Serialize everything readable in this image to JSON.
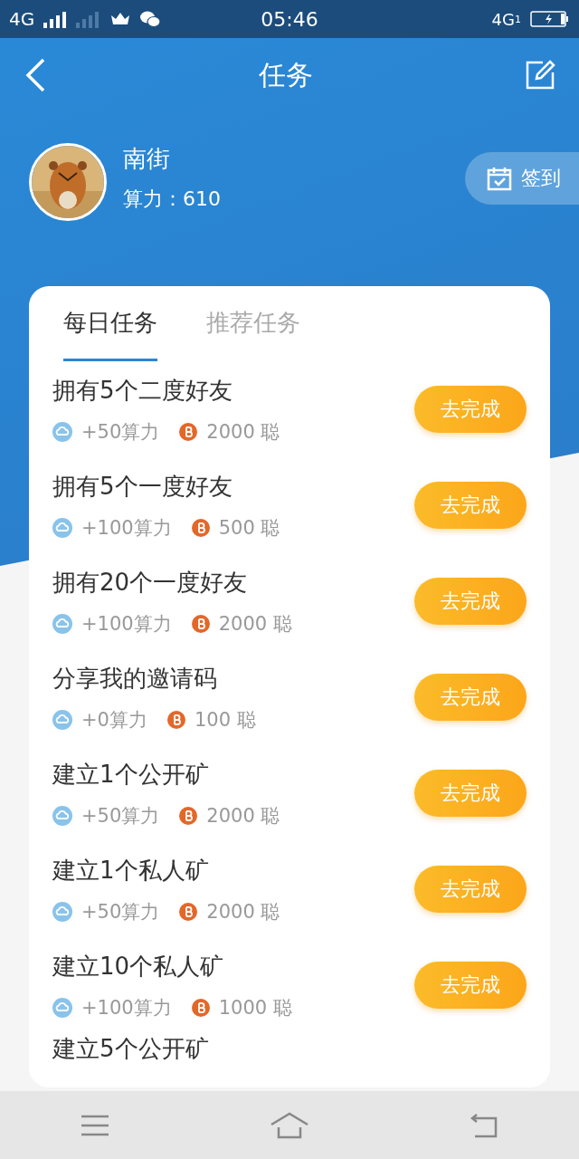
{
  "status_bar": {
    "network": "4G",
    "time": "05:46",
    "data_network": "4G",
    "sim": "1"
  },
  "header": {
    "title": "任务"
  },
  "profile": {
    "name": "南街",
    "power": "算力：610",
    "checkin": "签到"
  },
  "tabs": [
    {
      "label": "每日任务",
      "selected": true
    },
    {
      "label": "推荐任务",
      "selected": false
    }
  ],
  "tasks": [
    {
      "kind": "full",
      "title": "拥有5个二度好友",
      "power": "+50算力",
      "coins": "2000 聪",
      "action": "去完成"
    },
    {
      "kind": "full",
      "title": "拥有5个一度好友",
      "power": "+100算力",
      "coins": "500 聪",
      "action": "去完成"
    },
    {
      "kind": "full",
      "title": "拥有20个一度好友",
      "power": "+100算力",
      "coins": "2000 聪",
      "action": "去完成"
    },
    {
      "kind": "full",
      "title": "分享我的邀请码",
      "power": "+0算力",
      "coins": "100 聪",
      "action": "去完成"
    },
    {
      "kind": "full",
      "title": "建立1个公开矿",
      "power": "+50算力",
      "coins": "2000 聪",
      "action": "去完成"
    },
    {
      "kind": "full",
      "title": "建立1个私人矿",
      "power": "+50算力",
      "coins": "2000 聪",
      "action": "去完成"
    },
    {
      "kind": "full",
      "title": "建立10个私人矿",
      "power": "+100算力",
      "coins": "1000 聪",
      "action": "去完成"
    },
    {
      "kind": "partial",
      "title": "建立5个公开矿"
    }
  ]
}
